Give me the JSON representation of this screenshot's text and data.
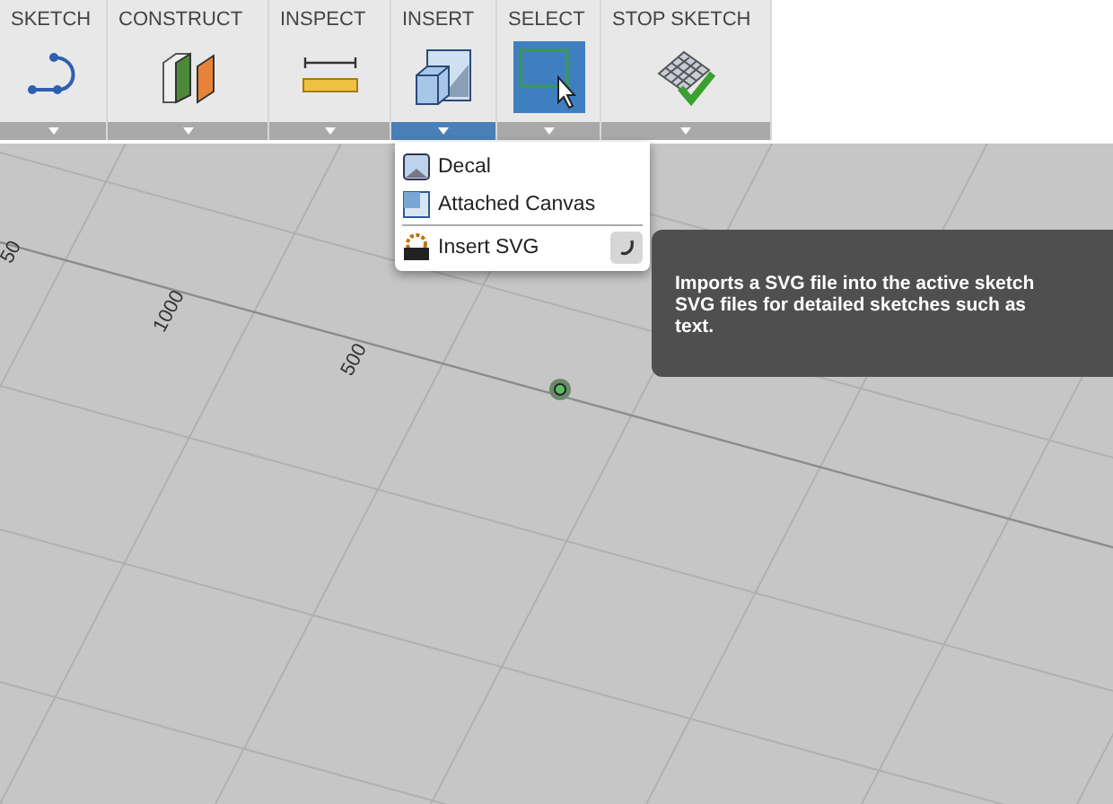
{
  "toolbar": {
    "groups": [
      {
        "label": "SKETCH",
        "kind": "sketch",
        "selected": false,
        "active": false
      },
      {
        "label": "CONSTRUCT",
        "kind": "construct",
        "selected": false,
        "active": false
      },
      {
        "label": "INSPECT",
        "kind": "inspect",
        "selected": false,
        "active": false
      },
      {
        "label": "INSERT",
        "kind": "insert",
        "selected": true,
        "active": false
      },
      {
        "label": "SELECT",
        "kind": "select",
        "selected": false,
        "active": true
      },
      {
        "label": "STOP SKETCH",
        "kind": "stop",
        "selected": false,
        "active": false
      }
    ]
  },
  "menu": {
    "items": [
      {
        "label": "Decal",
        "kind": "decal"
      },
      {
        "label": "Attached Canvas",
        "kind": "canvas"
      },
      {
        "label": "Insert SVG",
        "kind": "svg"
      }
    ]
  },
  "canvas": {
    "axis_labels": [
      "50",
      "1000",
      "500"
    ]
  },
  "tooltip": {
    "lines": [
      "Imports a SVG file into the active sketch",
      "SVG files for detailed sketches such as",
      "text."
    ]
  }
}
